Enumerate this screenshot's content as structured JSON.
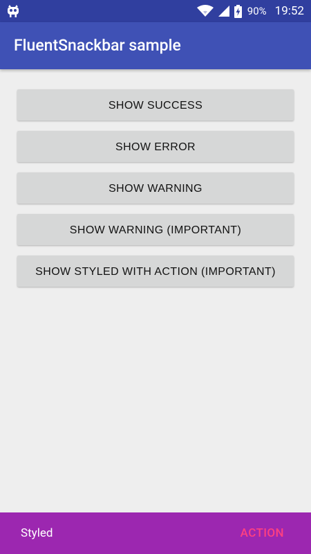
{
  "status_bar": {
    "left_icon": "android-debug-icon",
    "wifi_icon": "wifi-icon",
    "signal_icon": "cell-signal-icon",
    "battery_icon": "battery-charging-icon",
    "battery_percent": "90%",
    "time": "19:52"
  },
  "app_bar": {
    "title": "FluentSnackbar sample"
  },
  "buttons": [
    {
      "label": "SHOW SUCCESS"
    },
    {
      "label": "SHOW ERROR"
    },
    {
      "label": "SHOW WARNING"
    },
    {
      "label": "SHOW WARNING (IMPORTANT)"
    },
    {
      "label": "SHOW STYLED WITH ACTION (IMPORTANT)"
    }
  ],
  "snackbar": {
    "message": "Styled",
    "action_label": "ACTION"
  },
  "colors": {
    "status_bar": "#303f9f",
    "app_bar": "#3f51b5",
    "background": "#eeeeee",
    "button": "#d6d7d7",
    "snackbar": "#9c27b0",
    "snackbar_action": "#ff4081"
  }
}
